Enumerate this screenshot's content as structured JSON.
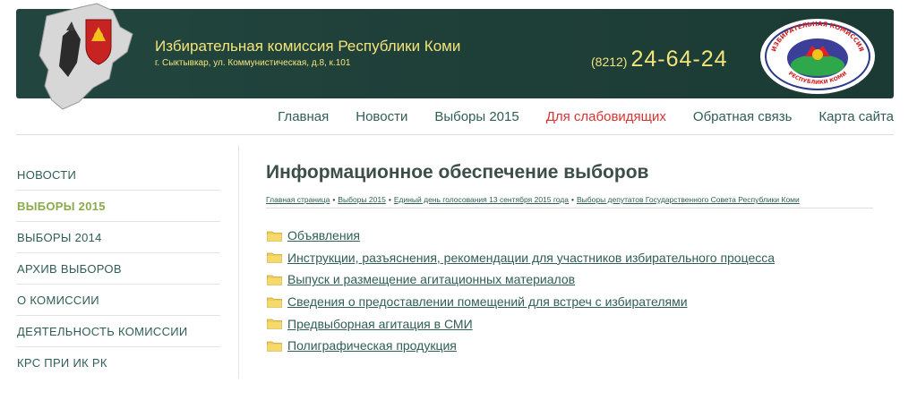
{
  "header": {
    "title": "Избирательная комиссия Республики Коми",
    "address": "г. Сыктывкар, ул. Коммунистическая, д.8, к.101",
    "phone_code": "(8212)",
    "phone_number": "24-64-24",
    "emblem_text_top": "ИЗБИРАТЕЛЬНАЯ КОМИССИЯ",
    "emblem_text_bottom": "РЕСПУБЛИКИ КОМИ",
    "colors": {
      "banner": "#1f4039",
      "title": "#f2e47a"
    }
  },
  "topnav": {
    "items": [
      {
        "label": "Главная"
      },
      {
        "label": "Новости"
      },
      {
        "label": "Выборы 2015"
      },
      {
        "label": "Для слабовидящих"
      },
      {
        "label": "Обратная связь"
      },
      {
        "label": "Карта сайта"
      }
    ]
  },
  "sidebar": {
    "items": [
      {
        "label": "НОВОСТИ"
      },
      {
        "label": "ВЫБОРЫ 2015"
      },
      {
        "label": "ВЫБОРЫ 2014"
      },
      {
        "label": "АРХИВ ВЫБОРОВ"
      },
      {
        "label": "О КОМИССИИ"
      },
      {
        "label": "ДЕЯТЕЛЬНОСТЬ КОМИССИИ"
      },
      {
        "label": "КРС ПРИ ИК РК"
      }
    ],
    "active_item": "ВЫБОРЫ 2015"
  },
  "main": {
    "title": "Информационное обеспечение выборов",
    "breadcrumb": [
      {
        "label": "Главная страница"
      },
      {
        "label": "Выборы 2015"
      },
      {
        "label": "Единый день голосования 13 сентября 2015 года"
      },
      {
        "label": "Выборы депутатов Государственного Совета Республики Коми"
      }
    ],
    "breadcrumb_separator": "•",
    "folders": [
      {
        "label": "Объявления",
        "icon": "folder-icon"
      },
      {
        "label": "Инструкции, разъяснения, рекомендации для участников избирательного процесса",
        "icon": "folder-icon"
      },
      {
        "label": "Выпуск и размещение агитационных материалов",
        "icon": "folder-icon"
      },
      {
        "label": "Сведения о предоставлении помещений для встреч с избирателями",
        "icon": "folder-icon"
      },
      {
        "label": "Предвыборная агитация в СМИ",
        "icon": "folder-icon"
      },
      {
        "label": "Полиграфическая продукция",
        "icon": "folder-icon"
      }
    ]
  }
}
